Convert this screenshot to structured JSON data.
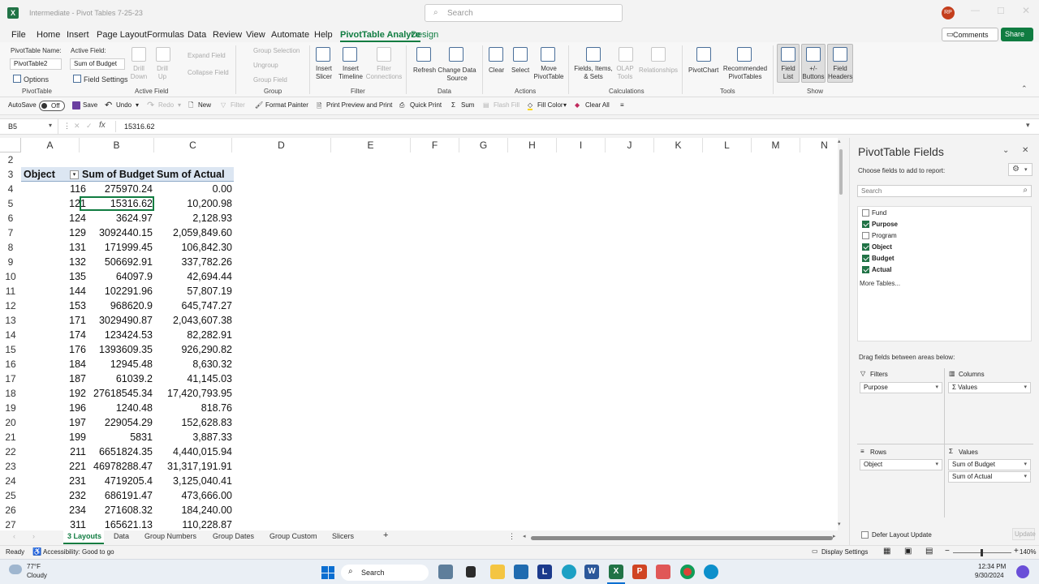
{
  "window": {
    "title": "Intermediate - Pivot Tables 7-25-23",
    "search_placeholder": "Search",
    "user_initials": "RP"
  },
  "menu": {
    "items": [
      "File",
      "Home",
      "Insert",
      "Page Layout",
      "Formulas",
      "Data",
      "Review",
      "View",
      "Automate",
      "Help",
      "PivotTable Analyze",
      "Design"
    ],
    "active": "PivotTable Analyze",
    "comments": "Comments",
    "share": "Share"
  },
  "ribbon": {
    "pt_name_label": "PivotTable Name:",
    "pt_name_value": "PivotTable2",
    "active_field_label": "Active Field:",
    "active_field_value": "Sum of Budget",
    "options": "Options",
    "field_settings": "Field Settings",
    "drill_down": "Drill Down",
    "drill_up": "Drill Up",
    "expand_field": "Expand Field",
    "collapse_field": "Collapse Field",
    "group_selection": "Group Selection",
    "ungroup": "Ungroup",
    "group_field": "Group Field",
    "insert_slicer": "Insert Slicer",
    "insert_timeline": "Insert Timeline",
    "filter_connections": "Filter Connections",
    "refresh": "Refresh",
    "change_data_source": "Change Data Source",
    "clear": "Clear",
    "select": "Select",
    "move_pivottable": "Move PivotTable",
    "fields_items_sets": "Fields, Items, & Sets",
    "olap_tools": "OLAP Tools",
    "relationships": "Relationships",
    "pivotchart": "PivotChart",
    "recommended": "Recommended PivotTables",
    "field_list": "Field List",
    "buttons": "+/- Buttons",
    "field_headers": "Field Headers",
    "groups": {
      "pivottable": "PivotTable",
      "active_field": "Active Field",
      "group": "Group",
      "filter": "Filter",
      "data": "Data",
      "actions": "Actions",
      "calculations": "Calculations",
      "tools": "Tools",
      "show": "Show"
    }
  },
  "qat": {
    "autosave": "AutoSave",
    "autosave_state": "Off",
    "save": "Save",
    "undo": "Undo",
    "redo": "Redo",
    "new": "New",
    "filter": "Filter",
    "format_painter": "Format Painter",
    "print_preview": "Print Preview and Print",
    "quick_print": "Quick Print",
    "sum": "Sum",
    "flash_fill": "Flash Fill",
    "fill_color": "Fill Color",
    "clear_all": "Clear All"
  },
  "formula_bar": {
    "name_box": "B5",
    "fx": "fx",
    "value": "15316.62"
  },
  "grid": {
    "columns": [
      "A",
      "B",
      "C",
      "D",
      "E",
      "F",
      "G",
      "H",
      "I",
      "J",
      "K",
      "L",
      "M",
      "N"
    ],
    "rows": [
      {
        "n": "2",
        "a": "",
        "b": "",
        "c": ""
      },
      {
        "n": "3",
        "a": "Object",
        "b": "Sum of Budget",
        "c": "Sum of Actual"
      },
      {
        "n": "4",
        "a": "116",
        "b": "275970.24",
        "c": "0.00"
      },
      {
        "n": "5",
        "a": "121",
        "b": "15316.62",
        "c": "10,200.98"
      },
      {
        "n": "6",
        "a": "124",
        "b": "3624.97",
        "c": "2,128.93"
      },
      {
        "n": "7",
        "a": "129",
        "b": "3092440.15",
        "c": "2,059,849.60"
      },
      {
        "n": "8",
        "a": "131",
        "b": "171999.45",
        "c": "106,842.30"
      },
      {
        "n": "9",
        "a": "132",
        "b": "506692.91",
        "c": "337,782.26"
      },
      {
        "n": "10",
        "a": "135",
        "b": "64097.9",
        "c": "42,694.44"
      },
      {
        "n": "11",
        "a": "144",
        "b": "102291.96",
        "c": "57,807.19"
      },
      {
        "n": "12",
        "a": "153",
        "b": "968620.9",
        "c": "645,747.27"
      },
      {
        "n": "13",
        "a": "171",
        "b": "3029490.87",
        "c": "2,043,607.38"
      },
      {
        "n": "14",
        "a": "174",
        "b": "123424.53",
        "c": "82,282.91"
      },
      {
        "n": "15",
        "a": "176",
        "b": "1393609.35",
        "c": "926,290.82"
      },
      {
        "n": "16",
        "a": "184",
        "b": "12945.48",
        "c": "8,630.32"
      },
      {
        "n": "17",
        "a": "187",
        "b": "61039.2",
        "c": "41,145.03"
      },
      {
        "n": "18",
        "a": "192",
        "b": "27618545.34",
        "c": "17,420,793.95"
      },
      {
        "n": "19",
        "a": "196",
        "b": "1240.48",
        "c": "818.76"
      },
      {
        "n": "20",
        "a": "197",
        "b": "229054.29",
        "c": "152,628.83"
      },
      {
        "n": "21",
        "a": "199",
        "b": "5831",
        "c": "3,887.33"
      },
      {
        "n": "22",
        "a": "211",
        "b": "6651824.35",
        "c": "4,440,015.94"
      },
      {
        "n": "23",
        "a": "221",
        "b": "46978288.47",
        "c": "31,317,191.91"
      },
      {
        "n": "24",
        "a": "231",
        "b": "4719205.4",
        "c": "3,125,040.41"
      },
      {
        "n": "25",
        "a": "232",
        "b": "686191.47",
        "c": "473,666.00"
      },
      {
        "n": "26",
        "a": "234",
        "b": "271608.32",
        "c": "184,240.00"
      },
      {
        "n": "27",
        "a": "311",
        "b": "165621.13",
        "c": "110,228.87"
      }
    ]
  },
  "pane": {
    "title": "PivotTable Fields",
    "subtitle": "Choose fields to add to report:",
    "search_placeholder": "Search",
    "fields": [
      {
        "label": "Fund",
        "checked": false
      },
      {
        "label": "Purpose",
        "checked": true
      },
      {
        "label": "Program",
        "checked": false
      },
      {
        "label": "Object",
        "checked": true
      },
      {
        "label": "Budget",
        "checked": true
      },
      {
        "label": "Actual",
        "checked": true
      }
    ],
    "more_tables": "More Tables...",
    "drag_label": "Drag fields between areas below:",
    "filters_label": "Filters",
    "filters_item": "Purpose",
    "columns_label": "Columns",
    "columns_item": "Σ Values",
    "rows_label": "Rows",
    "rows_item": "Object",
    "values_label": "Values",
    "values_items": [
      "Sum of Budget",
      "Sum of Actual"
    ],
    "defer": "Defer Layout Update",
    "update": "Update"
  },
  "sheets": {
    "tabs": [
      "3 Layouts",
      "Data",
      "Group Numbers",
      "Group Dates",
      "Group Custom",
      "Slicers"
    ],
    "active": "3 Layouts"
  },
  "status": {
    "ready": "Ready",
    "accessibility": "Accessibility: Good to go",
    "display_settings": "Display Settings",
    "zoom": "140%"
  },
  "taskbar": {
    "temp": "77°F",
    "weather": "Cloudy",
    "search": "Search",
    "time": "12:34 PM",
    "date": "9/30/2024"
  },
  "colors": {
    "excel_green": "#217346",
    "accent": "#107c41",
    "pivot_header": "#dce6f2"
  }
}
